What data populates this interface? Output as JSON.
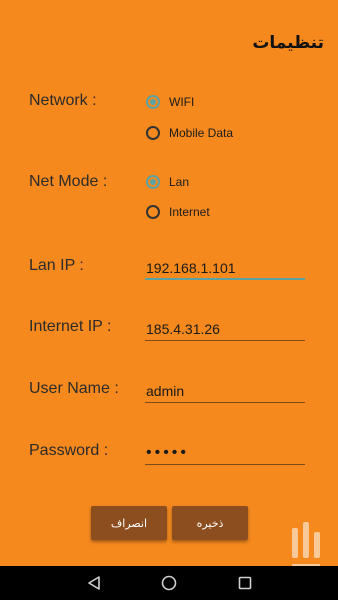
{
  "header": {
    "title": "تنظیمات"
  },
  "form": {
    "network": {
      "label": "Network :",
      "options": [
        {
          "label": "WIFI",
          "selected": true
        },
        {
          "label": "Mobile Data",
          "selected": false
        }
      ]
    },
    "net_mode": {
      "label": "Net Mode :",
      "options": [
        {
          "label": "Lan",
          "selected": true
        },
        {
          "label": "Internet",
          "selected": false
        }
      ]
    },
    "lan_ip": {
      "label": "Lan IP :",
      "value": "192.168.1.101"
    },
    "internet_ip": {
      "label": "Internet IP :",
      "value": "185.4.31.26"
    },
    "user_name": {
      "label": "User Name :",
      "value": "admin"
    },
    "password": {
      "label": "Password :",
      "value": "•••••"
    }
  },
  "buttons": {
    "cancel": "انصراف",
    "save": "ذخیره"
  },
  "colors": {
    "background": "#F5891E",
    "accent": "#5BA2A2",
    "button": "#8C4E1E"
  },
  "navbar": {
    "icons": [
      "back-icon",
      "home-icon",
      "recents-icon"
    ]
  }
}
